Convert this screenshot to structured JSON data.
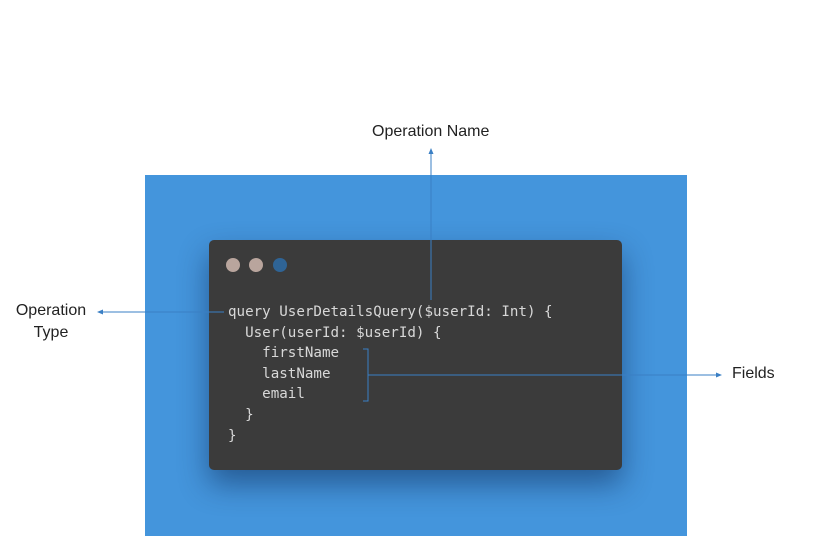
{
  "labels": {
    "operation_name": "Operation Name",
    "operation_type_line1": "Operation",
    "operation_type_line2": "Type",
    "fields": "Fields"
  },
  "window": {
    "dots": [
      "#b9a59d",
      "#b9a59d",
      "#2f6496"
    ]
  },
  "code_lines": [
    "query UserDetailsQuery($userId: Int) {",
    "  User(userId: $userId) {",
    "    firstName",
    "    lastName",
    "    email",
    "  }",
    "}"
  ],
  "colors": {
    "panel": "#4495dc",
    "code_background": "#3b3b3b",
    "code_text": "#d8d8d8",
    "annotation_line": "#3a7fc4"
  }
}
